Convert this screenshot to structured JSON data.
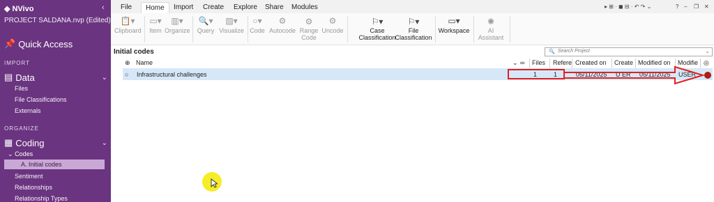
{
  "app": {
    "name": "NVivo",
    "project": "PROJECT SALDANA.nvp (Edited)",
    "collapse_glyph": "‹"
  },
  "sidebar": {
    "quick_access": "Quick Access",
    "import_header": "IMPORT",
    "data_label": "Data",
    "data_items": [
      "Files",
      "File Classifications",
      "Externals"
    ],
    "organize_header": "ORGANIZE",
    "coding_label": "Coding",
    "codes_label": "Codes",
    "active_item": "A. Initial codes",
    "coding_items": [
      "Sentiment",
      "Relationships",
      "Relationship Types"
    ]
  },
  "menu": {
    "tabs": [
      "File",
      "Home",
      "Import",
      "Create",
      "Explore",
      "Share",
      "Modules"
    ],
    "active_tab": "Home"
  },
  "ribbon": {
    "clipboard": "Clipboard",
    "item": "Item",
    "organize": "Organize",
    "query": "Query",
    "visualize": "Visualize",
    "code": "Code",
    "autocode": "Autocode",
    "range_code_1": "Range",
    "range_code_2": "Code",
    "uncode": "Uncode",
    "case_class_1": "Case",
    "case_class_2": "Classification",
    "file_class_1": "File",
    "file_class_2": "Classification",
    "workspace": "Workspace",
    "ai_1": "AI",
    "ai_2": "Assistant"
  },
  "content": {
    "title": "Initial codes",
    "search_placeholder": "Search Project",
    "columns": [
      "Name",
      "Files",
      "Refere",
      "Created on",
      "Create",
      "Modified on",
      "Modifie"
    ],
    "rows": [
      {
        "name": "Infrastructural challenges",
        "files": "1",
        "references": "1",
        "created_on": "05/11/2025",
        "created_by": "U  ER",
        "modified_on": "05/11/2025",
        "modified_by": "USER"
      }
    ]
  },
  "colors": {
    "sidebar": "#6a3480",
    "selected_row": "#d6e8f8",
    "annotation": "#e02020",
    "code_color_dot": "#b31b12"
  }
}
